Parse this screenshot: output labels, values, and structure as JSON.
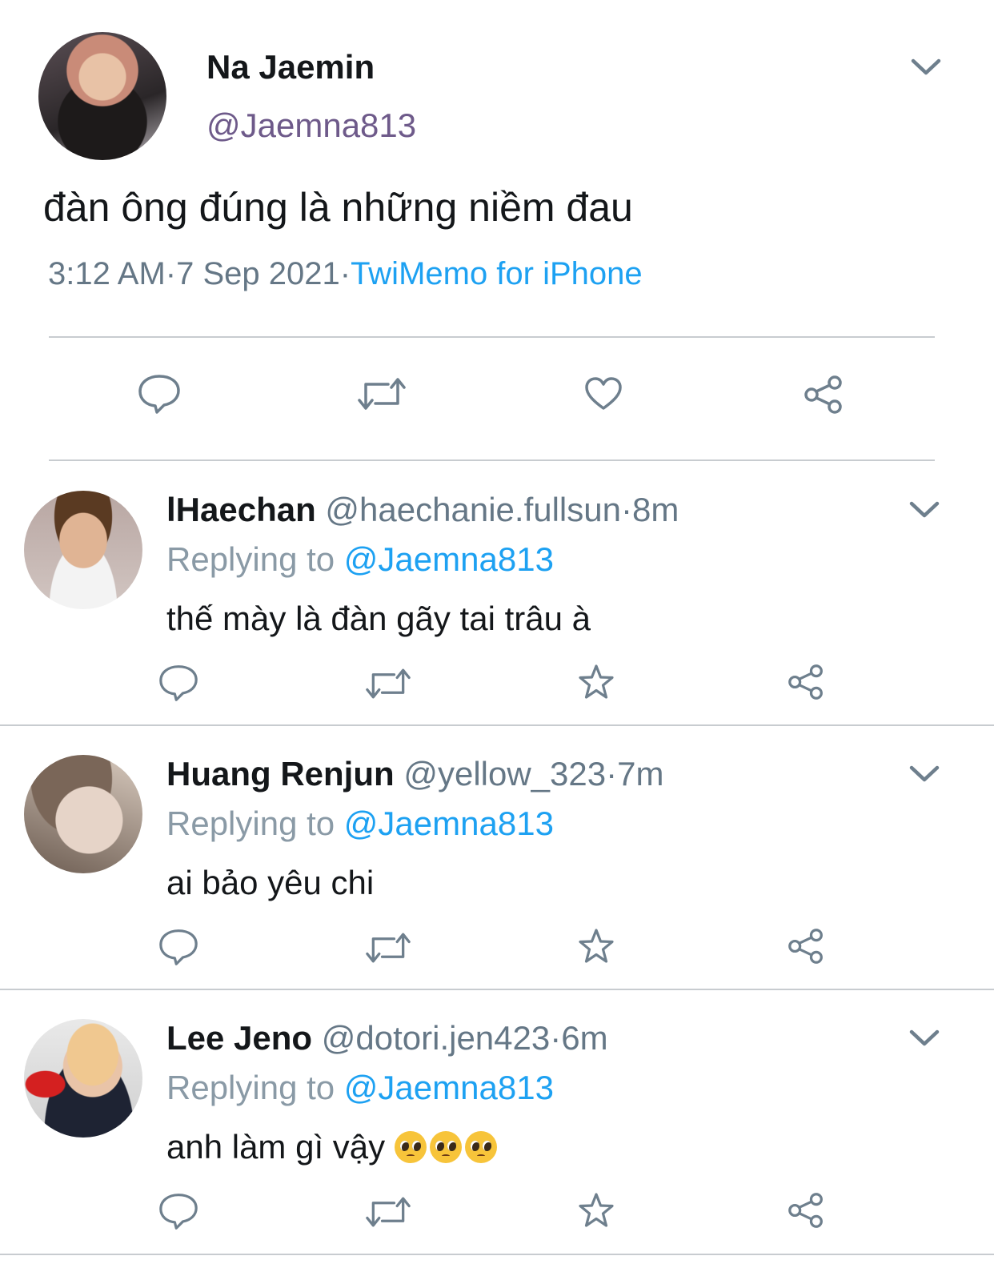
{
  "tweet": {
    "name": "Na Jaemin",
    "handle": "@Jaemna813",
    "text": "đàn ông đúng là những niềm đau",
    "time": "3:12 AM",
    "date": "7 Sep 2021",
    "source": "TwiMemo for iPhone",
    "separator": "·"
  },
  "icons": {
    "reply": "reply-icon",
    "retweet": "retweet-icon",
    "like": "heart-icon",
    "favorite": "star-icon",
    "share": "share-icon",
    "more": "chevron-down-icon"
  },
  "colors": {
    "accent": "#1da1f2",
    "muted": "#657786",
    "icon": "#6e7f8d"
  },
  "replies": [
    {
      "name": "lHaechan",
      "handle": "@haechanie.fullsun",
      "time": "·8m",
      "replying_label": "Replying to",
      "replying_to": "@Jaemna813",
      "text": "thế mày là đàn gãy tai trâu à",
      "emoji": ""
    },
    {
      "name": "Huang Renjun",
      "handle": "@yellow_323",
      "time": "·7m",
      "replying_label": "Replying to",
      "replying_to": "@Jaemna813",
      "text": "ai bảo yêu chi",
      "emoji": ""
    },
    {
      "name": "Lee Jeno",
      "handle": "@dotori.jen423",
      "time": "·6m",
      "replying_label": "Replying to",
      "replying_to": "@Jaemna813",
      "text": "anh làm gì vậy ",
      "emoji": "🥺🥺🥺"
    }
  ]
}
